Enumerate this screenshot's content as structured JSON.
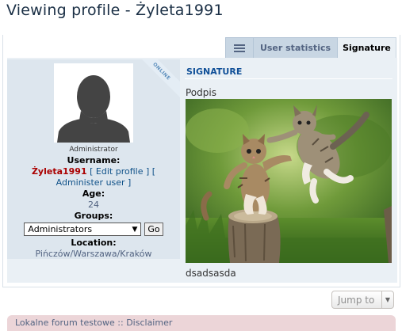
{
  "page": {
    "title": "Viewing profile - Żyleta1991"
  },
  "tabs": [
    {
      "label": "",
      "icon": "menu-icon"
    },
    {
      "label": "User statistics"
    },
    {
      "label": "Signature"
    }
  ],
  "profile": {
    "online_label": "ONLINE",
    "rank": "Administrator",
    "username_label": "Username:",
    "username": "Żyleta1991",
    "edit_profile": "[ Edit profile ] [",
    "administer_user": "Administer user ]",
    "age_label": "Age:",
    "age": "24",
    "groups_label": "Groups:",
    "group_selected": "Administrators",
    "go_button": "Go",
    "location_label": "Location:",
    "location": "Pińczów/Warszawa/Kraków"
  },
  "signature": {
    "heading": "SIGNATURE",
    "text": "Podpis",
    "footer_text": "dsadsasda",
    "image_name": "kittens-playing-image"
  },
  "jump_to": {
    "label": "Jump to"
  },
  "footer": {
    "text": "Lokalne forum testowe :: Disclaimer"
  }
}
